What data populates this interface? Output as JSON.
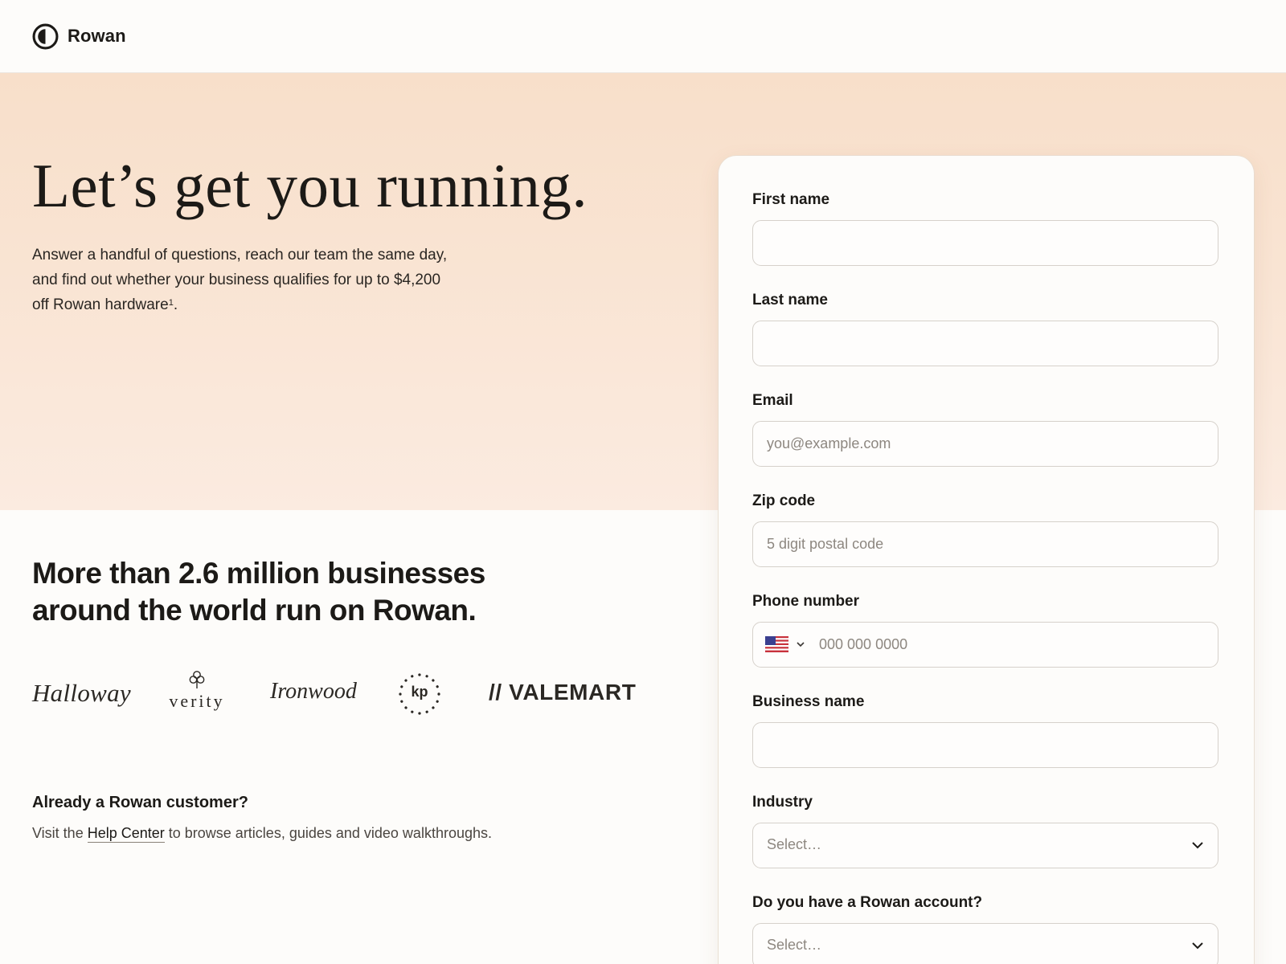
{
  "header": {
    "brand_name": "Rowan"
  },
  "hero": {
    "title": "Let’s get you running.",
    "subtitle": "Answer a handful of questions, reach our team the same day, and find out whether your business qualifies for up to $4,200 off Rowan hardware",
    "footnote_mark": "1",
    "subtitle_end": "."
  },
  "proof": {
    "title": "More than 2.6 million businesses around the world run on Rowan.",
    "logos": {
      "halloway": "Halloway",
      "verity": "verity",
      "ironwood": "Ironwood",
      "kp": "kp",
      "valemart": "// VALEMART"
    }
  },
  "existing": {
    "title": "Already a Rowan customer?",
    "text_before": "Visit the ",
    "link": "Help Center",
    "text_after": " to browse articles, guides and video walkthroughs."
  },
  "form": {
    "first_name": {
      "label": "First name",
      "value": "",
      "placeholder": ""
    },
    "last_name": {
      "label": "Last name",
      "value": "",
      "placeholder": ""
    },
    "email": {
      "label": "Email",
      "value": "",
      "placeholder": "you@example.com"
    },
    "zip": {
      "label": "Zip code",
      "value": "",
      "placeholder": "5 digit postal code"
    },
    "phone": {
      "label": "Phone number",
      "country_icon": "us-flag-icon",
      "value": "",
      "placeholder": "000 000 0000"
    },
    "business_name": {
      "label": "Business name",
      "value": "",
      "placeholder": ""
    },
    "industry": {
      "label": "Industry",
      "value": "Select…"
    },
    "has_account": {
      "label": "Do you have a Rowan account?",
      "value": "Select…"
    }
  },
  "colors": {
    "hero_background": "#f8dfca",
    "page_background": "#fdfcfa",
    "text": "#1c1a17",
    "input_border": "#d6d1cb",
    "placeholder": "#8d8780"
  }
}
